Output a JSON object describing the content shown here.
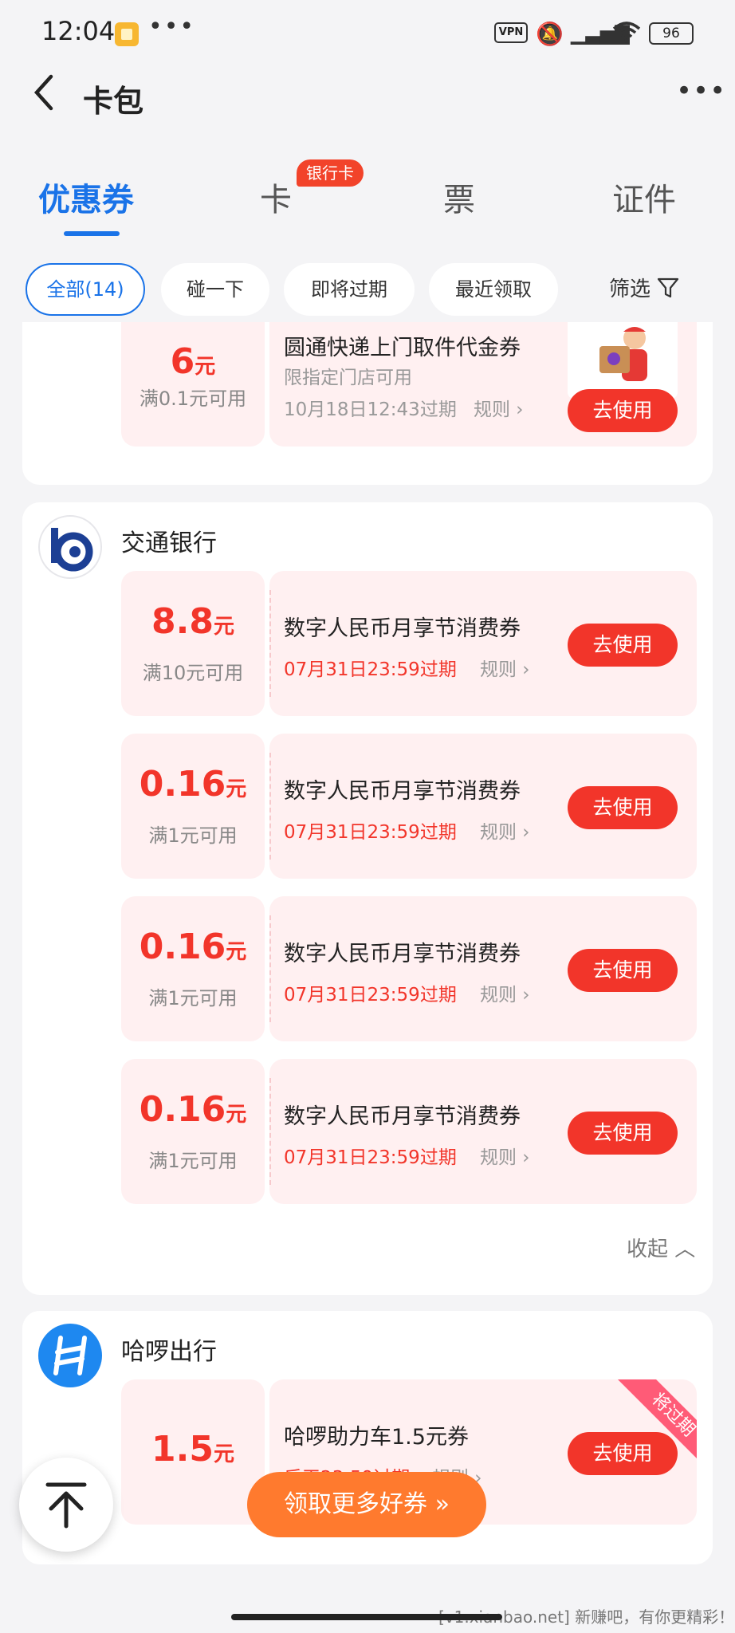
{
  "status_bar": {
    "time": "12:04",
    "vpn": "VPN",
    "battery": "96",
    "dots": "•••"
  },
  "header": {
    "back": "‹",
    "title": "卡包",
    "more": "•••"
  },
  "tabs": [
    {
      "label": "优惠券",
      "active": true
    },
    {
      "label": "卡",
      "badge": "银行卡"
    },
    {
      "label": "票"
    },
    {
      "label": "证件"
    }
  ],
  "filters": [
    {
      "label": "全部(14)",
      "active": true
    },
    {
      "label": "碰一下"
    },
    {
      "label": "即将过期"
    },
    {
      "label": "最近领取"
    }
  ],
  "filter_button": "筛选",
  "partial_card": {
    "amount": "6",
    "unit": "元",
    "condition": "满0.1元可用",
    "name": "圆通快递上门取件代金券",
    "subtitle": "限指定门店可用",
    "expiry": "10月18日12:43过期",
    "rule": "规则 ›",
    "button": "去使用"
  },
  "bocom": {
    "shop": "交通银行",
    "coupons": [
      {
        "amount": "8.8",
        "unit": "元",
        "condition": "满10元可用",
        "name": "数字人民币月享节消费券",
        "expiry": "07月31日23:59过期",
        "rule": "规则 ›",
        "button": "去使用"
      },
      {
        "amount": "0.16",
        "unit": "元",
        "condition": "满1元可用",
        "name": "数字人民币月享节消费券",
        "expiry": "07月31日23:59过期",
        "rule": "规则 ›",
        "button": "去使用"
      },
      {
        "amount": "0.16",
        "unit": "元",
        "condition": "满1元可用",
        "name": "数字人民币月享节消费券",
        "expiry": "07月31日23:59过期",
        "rule": "规则 ›",
        "button": "去使用"
      },
      {
        "amount": "0.16",
        "unit": "元",
        "condition": "满1元可用",
        "name": "数字人民币月享节消费券",
        "expiry": "07月31日23:59过期",
        "rule": "规则 ›",
        "button": "去使用"
      }
    ],
    "collapse": "收起 ︿"
  },
  "hello": {
    "shop": "哈啰出行",
    "coupon": {
      "amount": "1.5",
      "unit": "元",
      "name": "哈啰助力车1.5元券",
      "expiry": "后天23:59过期",
      "rule": "规则 ›",
      "button": "去使用",
      "ribbon": "将过期"
    }
  },
  "cta": "领取更多好券 »",
  "watermark": "[v1.xianbao.net] 新赚吧，有你更精彩！",
  "colors": {
    "accent": "#1a73e8",
    "coupon_red": "#f2352a",
    "coupon_bg": "#fff0f1",
    "cta_orange": "#ff7a2e"
  }
}
